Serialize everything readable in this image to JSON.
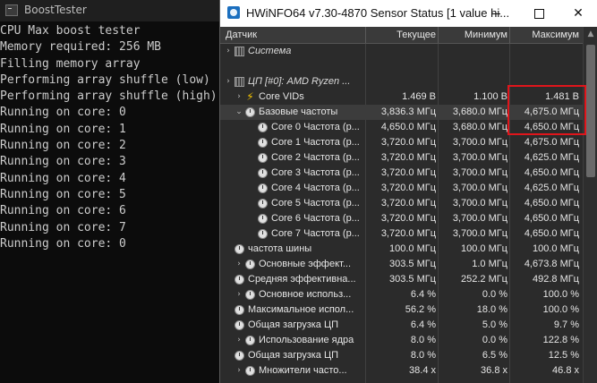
{
  "console": {
    "title": "BoostTester",
    "lines": [
      "CPU Max boost tester",
      "Memory required: 256 MB",
      "Filling memory array",
      "Performing array shuffle (low)",
      "Performing array shuffle (high)",
      "Running on core: 0",
      "Running on core: 1",
      "Running on core: 2",
      "Running on core: 3",
      "Running on core: 4",
      "Running on core: 5",
      "Running on core: 6",
      "Running on core: 7",
      "Running on core: 0"
    ]
  },
  "hwinfo": {
    "title": "HWiNFO64 v7.30-4870 Sensor Status [1 value hi...",
    "columns": [
      "Датчик",
      "Текущее",
      "Минимум",
      "Максимум"
    ],
    "highlight_color": "#e0151b",
    "rows": [
      {
        "name": "Система",
        "kind": "group",
        "level": 0,
        "chevron": "›",
        "icon": "chip-icon",
        "cur": "",
        "min": "",
        "max": ""
      },
      {
        "name": "",
        "kind": "blank",
        "level": 0,
        "chevron": "",
        "icon": "",
        "cur": "",
        "min": "",
        "max": ""
      },
      {
        "name": "ЦП [#0]: AMD Ryzen ...",
        "kind": "group",
        "level": 0,
        "chevron": "›",
        "icon": "chip-icon",
        "cur": "",
        "min": "",
        "max": ""
      },
      {
        "name": "Core VIDs",
        "kind": "sensor",
        "level": 1,
        "chevron": "›",
        "icon": "bolt-icon",
        "cur": "1.469 В",
        "min": "1.100 В",
        "max": "1.481 В"
      },
      {
        "name": "Базовые частоты",
        "kind": "sensor",
        "level": 1,
        "chevron": "⌄",
        "icon": "clock-icon",
        "cur": "3,836.3 МГц",
        "min": "3,680.0 МГц",
        "max": "4,675.0 МГц",
        "hl": true
      },
      {
        "name": "Core 0 Частота (р...",
        "kind": "sensor",
        "level": 2,
        "chevron": "",
        "icon": "clock-icon",
        "cur": "4,650.0 МГц",
        "min": "3,680.0 МГц",
        "max": "4,650.0 МГц"
      },
      {
        "name": "Core 1 Частота (р...",
        "kind": "sensor",
        "level": 2,
        "chevron": "",
        "icon": "clock-icon",
        "cur": "3,720.0 МГц",
        "min": "3,700.0 МГц",
        "max": "4,675.0 МГц"
      },
      {
        "name": "Core 2 Частота (р...",
        "kind": "sensor",
        "level": 2,
        "chevron": "",
        "icon": "clock-icon",
        "cur": "3,720.0 МГц",
        "min": "3,700.0 МГц",
        "max": "4,625.0 МГц"
      },
      {
        "name": "Core 3 Частота (р...",
        "kind": "sensor",
        "level": 2,
        "chevron": "",
        "icon": "clock-icon",
        "cur": "3,720.0 МГц",
        "min": "3,700.0 МГц",
        "max": "4,650.0 МГц"
      },
      {
        "name": "Core 4 Частота (р...",
        "kind": "sensor",
        "level": 2,
        "chevron": "",
        "icon": "clock-icon",
        "cur": "3,720.0 МГц",
        "min": "3,700.0 МГц",
        "max": "4,625.0 МГц"
      },
      {
        "name": "Core 5 Частота (р...",
        "kind": "sensor",
        "level": 2,
        "chevron": "",
        "icon": "clock-icon",
        "cur": "3,720.0 МГц",
        "min": "3,700.0 МГц",
        "max": "4,650.0 МГц"
      },
      {
        "name": "Core 6 Частота (р...",
        "kind": "sensor",
        "level": 2,
        "chevron": "",
        "icon": "clock-icon",
        "cur": "3,720.0 МГц",
        "min": "3,700.0 МГц",
        "max": "4,650.0 МГц"
      },
      {
        "name": "Core 7 Частота (р...",
        "kind": "sensor",
        "level": 2,
        "chevron": "",
        "icon": "clock-icon",
        "cur": "3,720.0 МГц",
        "min": "3,700.0 МГц",
        "max": "4,650.0 МГц"
      },
      {
        "name": "частота шины",
        "kind": "sensor",
        "level": 0,
        "chevron": "",
        "icon": "clock-icon",
        "cur": "100.0 МГц",
        "min": "100.0 МГц",
        "max": "100.0 МГц"
      },
      {
        "name": "Основные эффект...",
        "kind": "sensor",
        "level": 1,
        "chevron": "›",
        "icon": "clock-icon",
        "cur": "303.5 МГц",
        "min": "1.0 МГц",
        "max": "4,673.8 МГц"
      },
      {
        "name": "Средняя эффективна...",
        "kind": "sensor",
        "level": 0,
        "chevron": "",
        "icon": "clock-icon",
        "cur": "303.5 МГц",
        "min": "252.2 МГц",
        "max": "492.8 МГц"
      },
      {
        "name": "Основное использ...",
        "kind": "sensor",
        "level": 1,
        "chevron": "›",
        "icon": "clock-icon",
        "cur": "6.4 %",
        "min": "0.0 %",
        "max": "100.0 %"
      },
      {
        "name": "Максимальное испол...",
        "kind": "sensor",
        "level": 0,
        "chevron": "",
        "icon": "clock-icon",
        "cur": "56.2 %",
        "min": "18.0 %",
        "max": "100.0 %"
      },
      {
        "name": "Общая загрузка ЦП",
        "kind": "sensor",
        "level": 0,
        "chevron": "",
        "icon": "clock-icon",
        "cur": "6.4 %",
        "min": "5.0 %",
        "max": "9.7 %"
      },
      {
        "name": "Использование ядра",
        "kind": "sensor",
        "level": 1,
        "chevron": "›",
        "icon": "clock-icon",
        "cur": "8.0 %",
        "min": "0.0 %",
        "max": "122.8 %"
      },
      {
        "name": "Общая загрузка ЦП",
        "kind": "sensor",
        "level": 0,
        "chevron": "",
        "icon": "clock-icon",
        "cur": "8.0 %",
        "min": "6.5 %",
        "max": "12.5 %"
      },
      {
        "name": "Множители часто...",
        "kind": "sensor",
        "level": 1,
        "chevron": "›",
        "icon": "clock-icon",
        "cur": "38.4 x",
        "min": "36.8 x",
        "max": "46.8 x"
      }
    ]
  }
}
